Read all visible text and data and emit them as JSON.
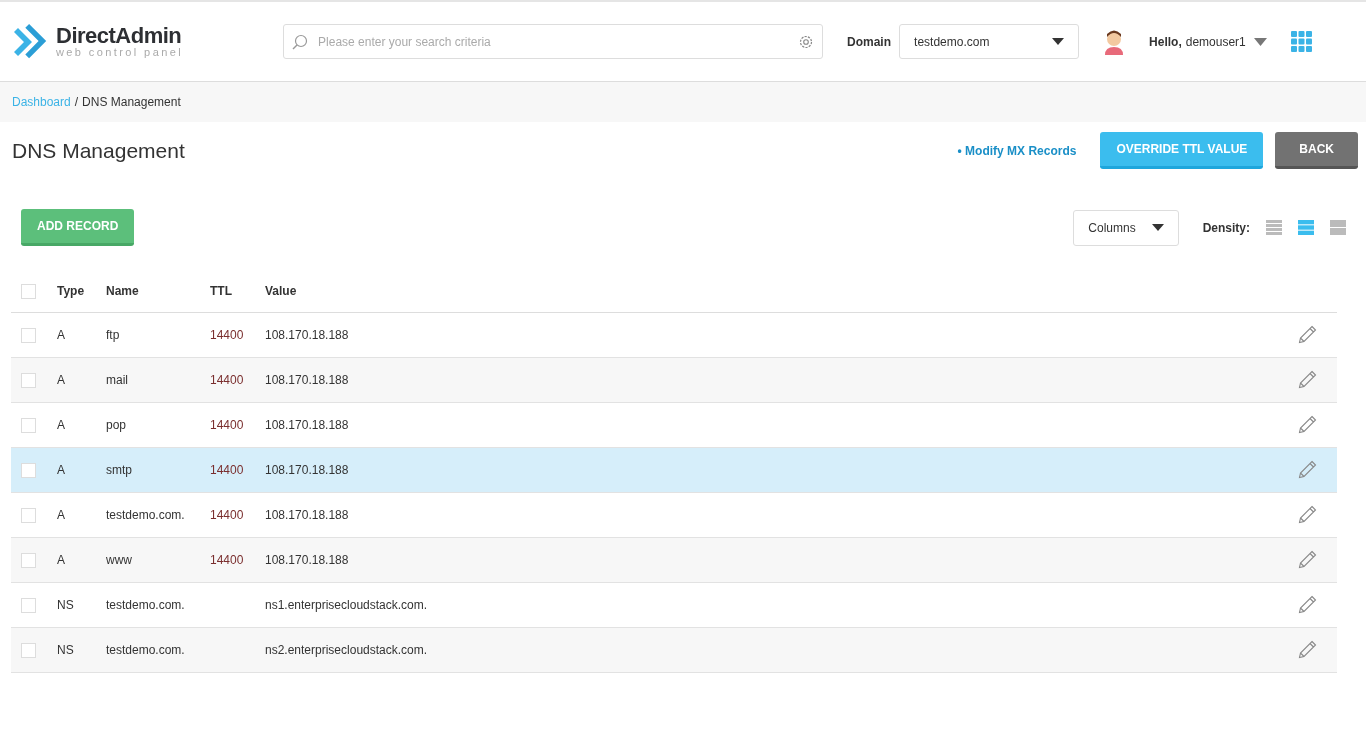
{
  "header": {
    "logo_title": "DirectAdmin",
    "logo_subtitle": "web control panel",
    "search": {
      "placeholder": "Please enter your search criteria"
    },
    "domain_label": "Domain",
    "domain_value": "testdemo.com",
    "greeting": "Hello,",
    "username": "demouser1"
  },
  "breadcrumb": [
    {
      "label": "Dashboard",
      "link": true
    },
    {
      "label": "DNS Management",
      "link": false
    }
  ],
  "breadcrumb_separator": "/",
  "page_title": "DNS Management",
  "actions": {
    "link": "• Modify MX Records",
    "primary": "OVERRIDE TTL VALUE",
    "back": "BACK"
  },
  "toolbar": {
    "add": "ADD RECORD",
    "columns": "Columns",
    "density_label": "Density:",
    "density": [
      {
        "kind": "compact",
        "selected": false
      },
      {
        "kind": "normal",
        "selected": true
      },
      {
        "kind": "comfortable",
        "selected": false
      }
    ]
  },
  "table": {
    "columns": [
      "Type",
      "Name",
      "TTL",
      "Value"
    ],
    "header_checked": false,
    "rows": [
      {
        "type": "A",
        "name": "ftp",
        "ttl": "14400",
        "value": "108.170.18.188",
        "checked": false,
        "highlighted": false
      },
      {
        "type": "A",
        "name": "mail",
        "ttl": "14400",
        "value": "108.170.18.188",
        "checked": false,
        "highlighted": false
      },
      {
        "type": "A",
        "name": "pop",
        "ttl": "14400",
        "value": "108.170.18.188",
        "checked": false,
        "highlighted": false
      },
      {
        "type": "A",
        "name": "smtp",
        "ttl": "14400",
        "value": "108.170.18.188",
        "checked": false,
        "highlighted": true
      },
      {
        "type": "A",
        "name": "testdemo.com.",
        "ttl": "14400",
        "value": "108.170.18.188",
        "checked": false,
        "highlighted": false
      },
      {
        "type": "A",
        "name": "www",
        "ttl": "14400",
        "value": "108.170.18.188",
        "checked": false,
        "highlighted": false
      },
      {
        "type": "NS",
        "name": "testdemo.com.",
        "ttl": "",
        "value": "ns1.enterprisecloudstack.com.",
        "checked": false,
        "highlighted": false
      },
      {
        "type": "NS",
        "name": "testdemo.com.",
        "ttl": "",
        "value": "ns2.enterprisecloudstack.com.",
        "checked": false,
        "highlighted": false
      }
    ]
  }
}
